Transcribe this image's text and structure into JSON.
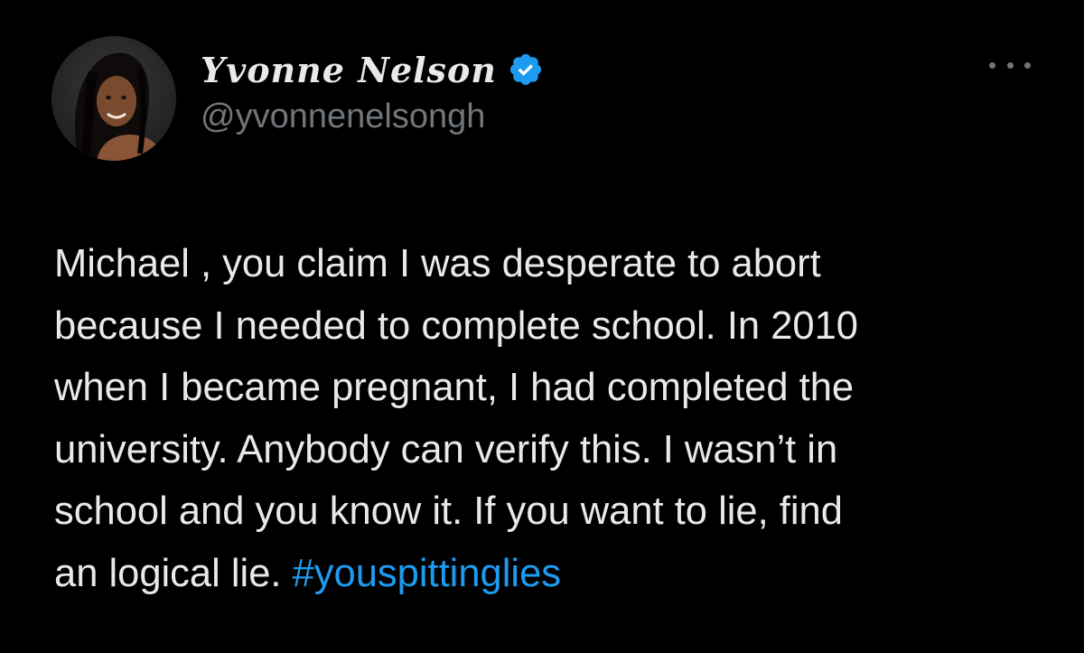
{
  "author": {
    "display_name": "Yvonne Nelson",
    "handle": "@yvonnenelsongh",
    "verified": true
  },
  "tweet": {
    "lines": [
      "Michael , you claim I was desperate to abort",
      "because I needed to complete school. In 2010",
      "when I became pregnant, I had completed the",
      "university. Anybody can verify this. I wasn’t in",
      "school and you know it. If you want to lie, find"
    ],
    "last_line_text": "an logical lie.",
    "hashtag": "#youspittinglies"
  },
  "icons": {
    "verified": "verified-badge-icon",
    "more": "more-options-icon"
  },
  "colors": {
    "background": "#000000",
    "text_primary": "#e7e9ea",
    "text_secondary": "#71767b",
    "link": "#1d9bf0"
  }
}
